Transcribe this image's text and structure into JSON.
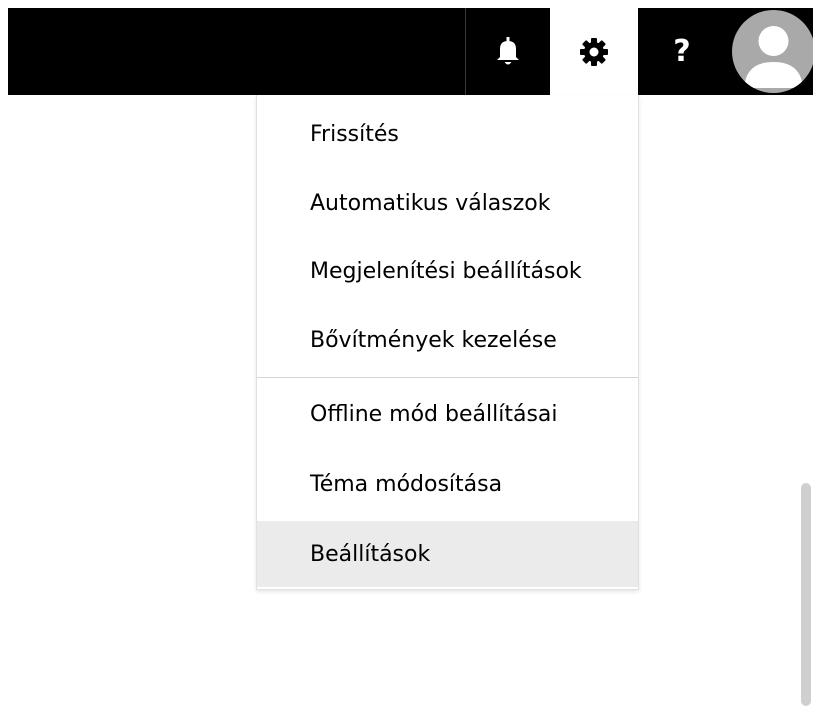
{
  "topbar": {
    "notifications_icon": "bell-icon",
    "settings_icon": "gear-icon",
    "help_icon": "question-icon",
    "help_glyph": "?",
    "avatar_icon": "person-icon"
  },
  "settings_menu": {
    "items": [
      {
        "label": "Frissítés"
      },
      {
        "label": "Automatikus válaszok"
      },
      {
        "label": "Megjelenítési beállítások"
      },
      {
        "label": "Bővítmények kezelése"
      },
      {
        "label": "Offline mód beállításai"
      },
      {
        "label": "Téma módosítása"
      },
      {
        "label": "Beállítások",
        "highlighted": true
      }
    ]
  },
  "colors": {
    "topbar_bg": "#000000",
    "selected_tab_bg": "#ffffff",
    "highlight_bg": "#ebebeb",
    "avatar_bg": "#a9a9a9",
    "scrollbar": "#cfcfcf"
  }
}
